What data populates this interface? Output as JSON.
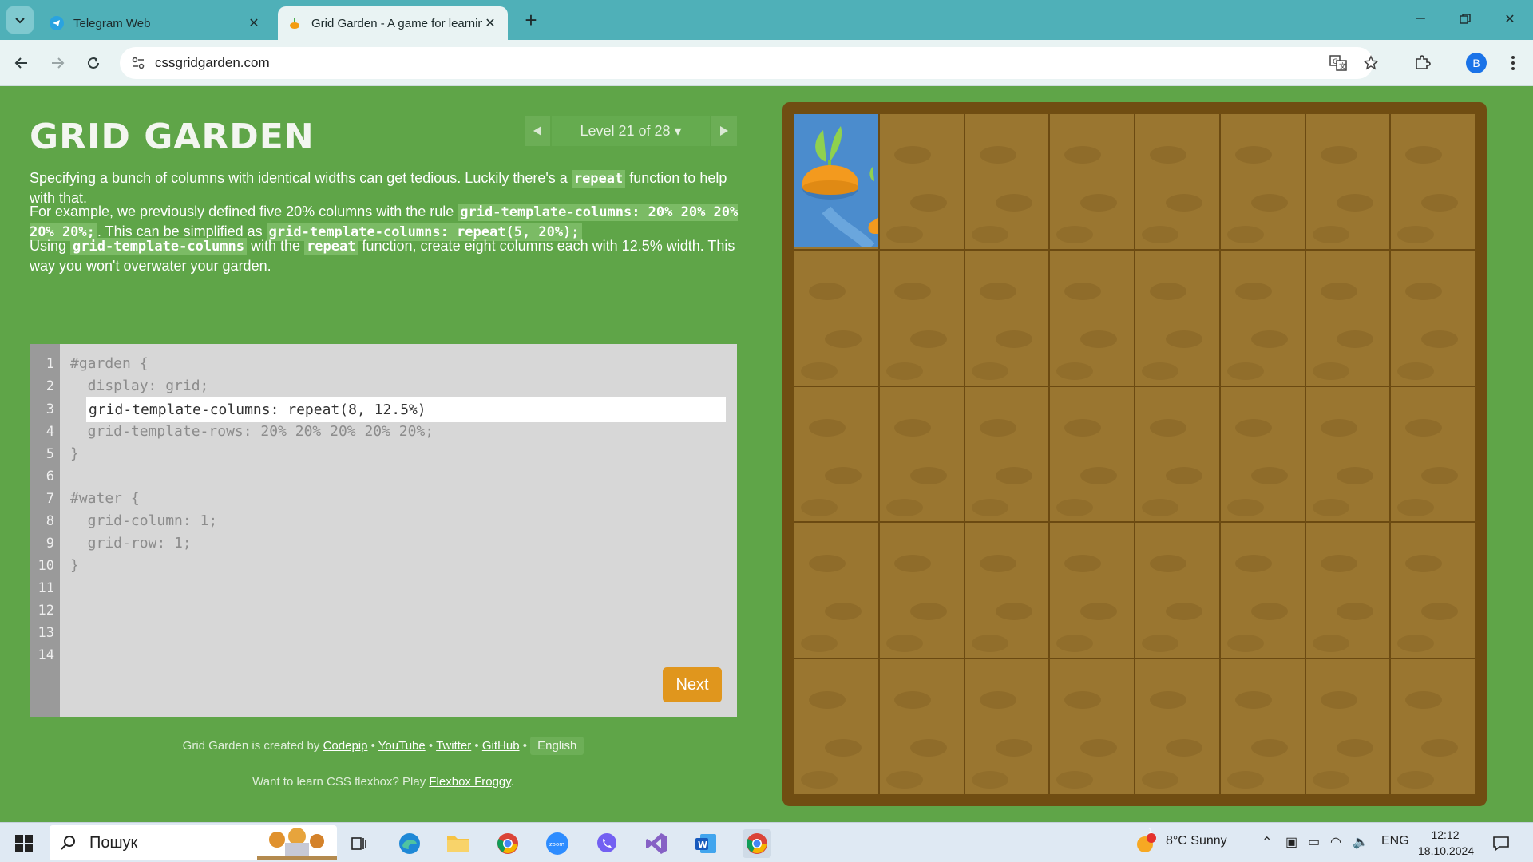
{
  "browser": {
    "tabs": [
      {
        "title": "Telegram Web",
        "active": false
      },
      {
        "title": "Grid Garden - A game for learning CSS grid",
        "active": true
      }
    ],
    "url": "cssgridgarden.com",
    "profile_initial": "B"
  },
  "game": {
    "title": "GRID GARDEN",
    "level_label": "Level 21 of 28 ▾",
    "instructions": {
      "p1_text": "Specifying a bunch of columns with identical widths can get tedious. Luckily there's a",
      "p1_code": "repeat",
      "p1_tail": "function to help with that.",
      "p2_text": "For example, we previously defined five 20% columns with the rule",
      "p2_code1": "grid-template-columns: 20% 20% 20% 20% 20%;",
      "p2_mid": ". This can be simplified as",
      "p2_code2": "grid-template-columns: repeat(5, 20%);",
      "p3_text1": "Using",
      "p3_code1": "grid-template-columns",
      "p3_text2": "with the",
      "p3_code2": "repeat",
      "p3_text3": "function, create eight columns each with 12.5% width. This way you won't overwater your garden."
    },
    "editor": {
      "line_numbers": [
        "1",
        "2",
        "3",
        "4",
        "5",
        "6",
        "7",
        "8",
        "9",
        "10",
        "11",
        "12",
        "13",
        "14"
      ],
      "lines": [
        "#garden {",
        "  display: grid;",
        "",
        "  grid-template-rows: 20% 20% 20% 20% 20%;",
        "}",
        "",
        "#water {",
        "  grid-column: 1;",
        "  grid-row: 1;",
        "}",
        "",
        "",
        "",
        ""
      ],
      "input_value": "grid-template-columns: repeat(8, 12.5%)",
      "next_label": "Next"
    },
    "credits": {
      "prefix": "Grid Garden is created by",
      "link1": "Codepip",
      "link2": "YouTube",
      "link3": "Twitter",
      "link4": "GitHub",
      "sep": " • ",
      "language": "English",
      "froggy_prefix": "Want to learn CSS flexbox? Play",
      "froggy_link": "Flexbox Froggy",
      "froggy_suffix": "."
    },
    "colors": {
      "page_bg": "#5fa548",
      "soil": "#9a7630",
      "water": "#4b8ccd",
      "next_button": "#e0961d"
    }
  },
  "taskbar": {
    "search_placeholder": "Пошук",
    "weather": "8°C  Sunny",
    "weather_badge": "1",
    "language": "ENG",
    "time": "12:12",
    "date": "18.10.2024"
  }
}
